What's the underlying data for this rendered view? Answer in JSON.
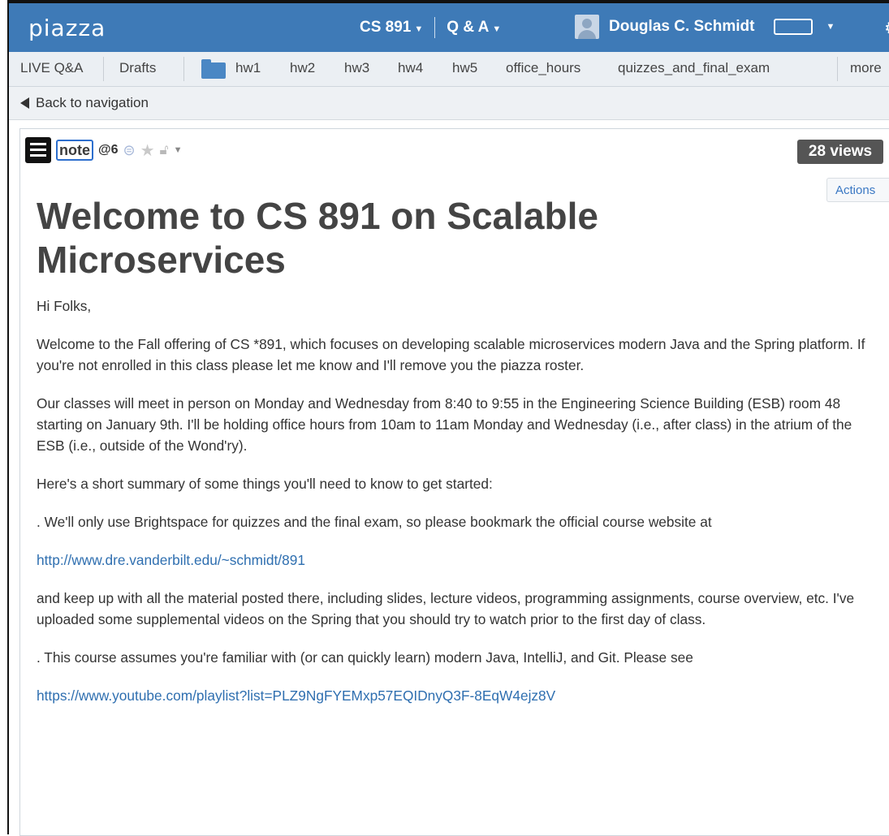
{
  "app": {
    "logo": "piazza"
  },
  "topbar": {
    "course": "CS 891",
    "section": "Q & A",
    "user": "Douglas C. Schmidt"
  },
  "folders": {
    "live": "LIVE Q&A",
    "drafts": "Drafts",
    "items": [
      "hw1",
      "hw2",
      "hw3",
      "hw4",
      "hw5",
      "office_hours",
      "quizzes_and_final_exam"
    ],
    "more": "more"
  },
  "back": {
    "label": "Back to navigation"
  },
  "post": {
    "type_label": "note",
    "number": "@6",
    "views": "28 views",
    "actions": "Actions",
    "title": "Welcome to CS 891 on Scalable Microservices",
    "paragraphs": [
      "Hi Folks,",
      "Welcome to the Fall offering of CS *891, which focuses on developing scalable microservices modern Java and the Spring platform. If you're not enrolled in this class please let me know and I'll remove you the piazza roster.",
      "Our classes will meet in person on Monday and Wednesday from 8:40 to 9:55 in the Engineering Science Building (ESB) room 48 starting on January 9th. I'll be holding office hours from 10am to 11am Monday and Wednesday (i.e., after class) in the atrium of the ESB (i.e., outside of the Wond'ry).",
      "Here's a short summary of some things you'll need to know to get started:",
      ". We'll only use Brightspace for quizzes and the final exam, so please bookmark the official course website at"
    ],
    "link1": "http://www.dre.vanderbilt.edu/~schmidt/891",
    "paragraphs2": [
      "and keep up with all the material posted there, including slides, lecture videos, programming assignments, course overview, etc. I've uploaded some supplemental videos on the Spring that you should try to watch prior to the first day of class.",
      ". This course assumes you're familiar with (or can quickly learn) modern Java, IntelliJ, and Git. Please see"
    ],
    "link2": "https://www.youtube.com/playlist?list=PLZ9NgFYEMxp57EQIDnyQ3F-8EqW4ejz8V"
  },
  "colors": {
    "brand": "#3e7ab7",
    "link": "#2f6fb0",
    "views_badge": "#555555"
  }
}
